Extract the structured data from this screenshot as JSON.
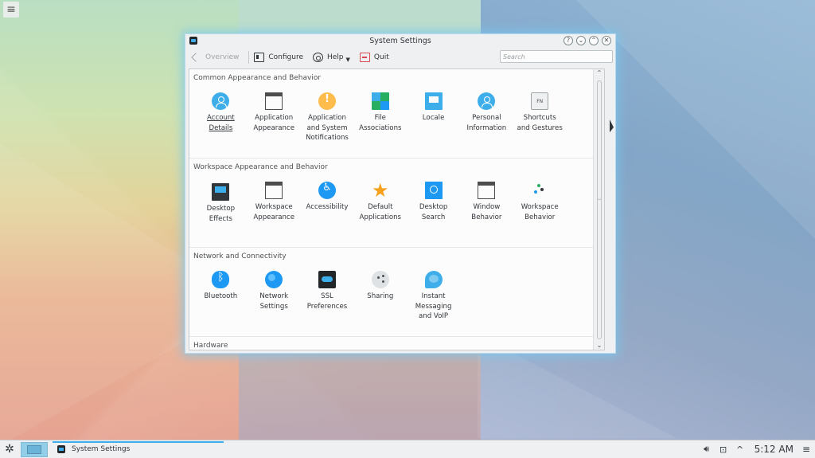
{
  "window": {
    "title": "System Settings",
    "buttons": [
      "?",
      "⌄",
      "⌃",
      "✕"
    ]
  },
  "toolbar": {
    "overview": "Overview",
    "configure": "Configure",
    "help": "Help",
    "quit": "Quit",
    "search_placeholder": "Search"
  },
  "sections": [
    {
      "title": "Common Appearance and Behavior",
      "items": [
        {
          "label": "Account\nDetails",
          "icon": "user-icon"
        },
        {
          "label": "Application\nAppearance",
          "icon": "window-icon"
        },
        {
          "label": "Application\nand System\nNotifications",
          "icon": "notification-icon"
        },
        {
          "label": "File\nAssociations",
          "icon": "file-associations-icon"
        },
        {
          "label": "Locale",
          "icon": "locale-icon"
        },
        {
          "label": "Personal\nInformation",
          "icon": "user-icon"
        },
        {
          "label": "Shortcuts\nand Gestures",
          "icon": "keyboard-fn-icon"
        }
      ]
    },
    {
      "title": "Workspace Appearance and Behavior",
      "items": [
        {
          "label": "Desktop\nEffects",
          "icon": "desktop-effects-icon"
        },
        {
          "label": "Workspace\nAppearance",
          "icon": "window-icon"
        },
        {
          "label": "Accessibility",
          "icon": "accessibility-icon"
        },
        {
          "label": "Default\nApplications",
          "icon": "star-icon"
        },
        {
          "label": "Desktop\nSearch",
          "icon": "search-icon"
        },
        {
          "label": "Window\nBehavior",
          "icon": "window-icon"
        },
        {
          "label": "Workspace\nBehavior",
          "icon": "workspace-behavior-icon"
        }
      ]
    },
    {
      "title": "Network and Connectivity",
      "items": [
        {
          "label": "Bluetooth",
          "icon": "bluetooth-icon"
        },
        {
          "label": "Network\nSettings",
          "icon": "network-icon"
        },
        {
          "label": "SSL\nPreferences",
          "icon": "ssl-icon"
        },
        {
          "label": "Sharing",
          "icon": "sharing-icon"
        },
        {
          "label": "Instant\nMessaging\nand VoIP",
          "icon": "chat-icon"
        }
      ]
    },
    {
      "title": "Hardware",
      "items": []
    }
  ],
  "taskbar": {
    "task_label": "System Settings",
    "clock": "5:12 AM"
  }
}
